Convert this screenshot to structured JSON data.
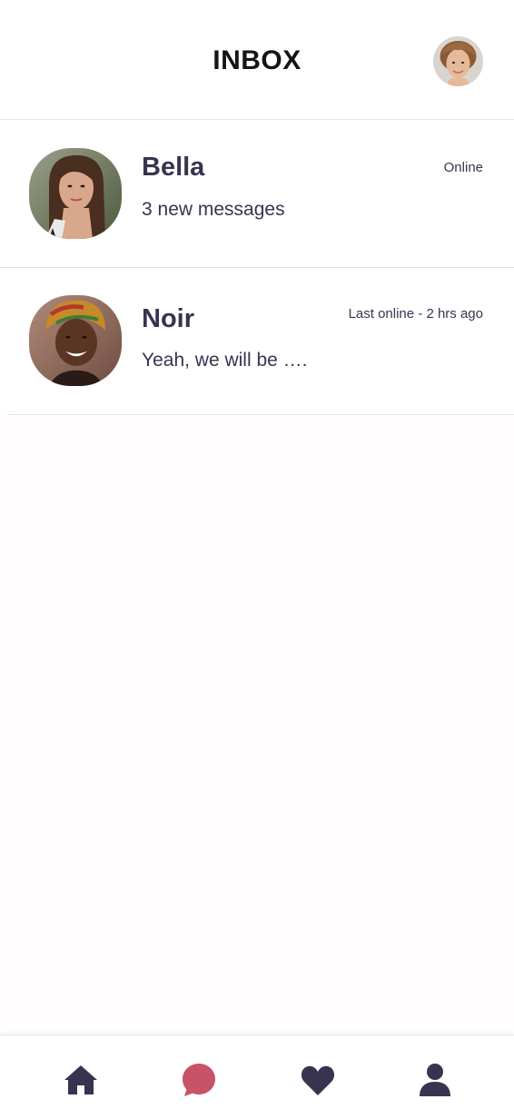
{
  "header": {
    "title": "INBOX"
  },
  "conversations": [
    {
      "name": "Bella",
      "status": "Online",
      "preview": "3 new messages"
    },
    {
      "name": "Noir",
      "status": "Last online - 2 hrs ago",
      "preview": "Yeah, we will be …."
    }
  ],
  "nav": {
    "items": [
      {
        "icon": "home-icon"
      },
      {
        "icon": "chat-bubble-icon",
        "active": true
      },
      {
        "icon": "heart-icon"
      },
      {
        "icon": "user-icon"
      }
    ]
  },
  "colors": {
    "text": "#36344f",
    "title": "#151515",
    "nav_icon": "#36344f",
    "nav_active": "#c85266",
    "background": "#fffdfd"
  }
}
